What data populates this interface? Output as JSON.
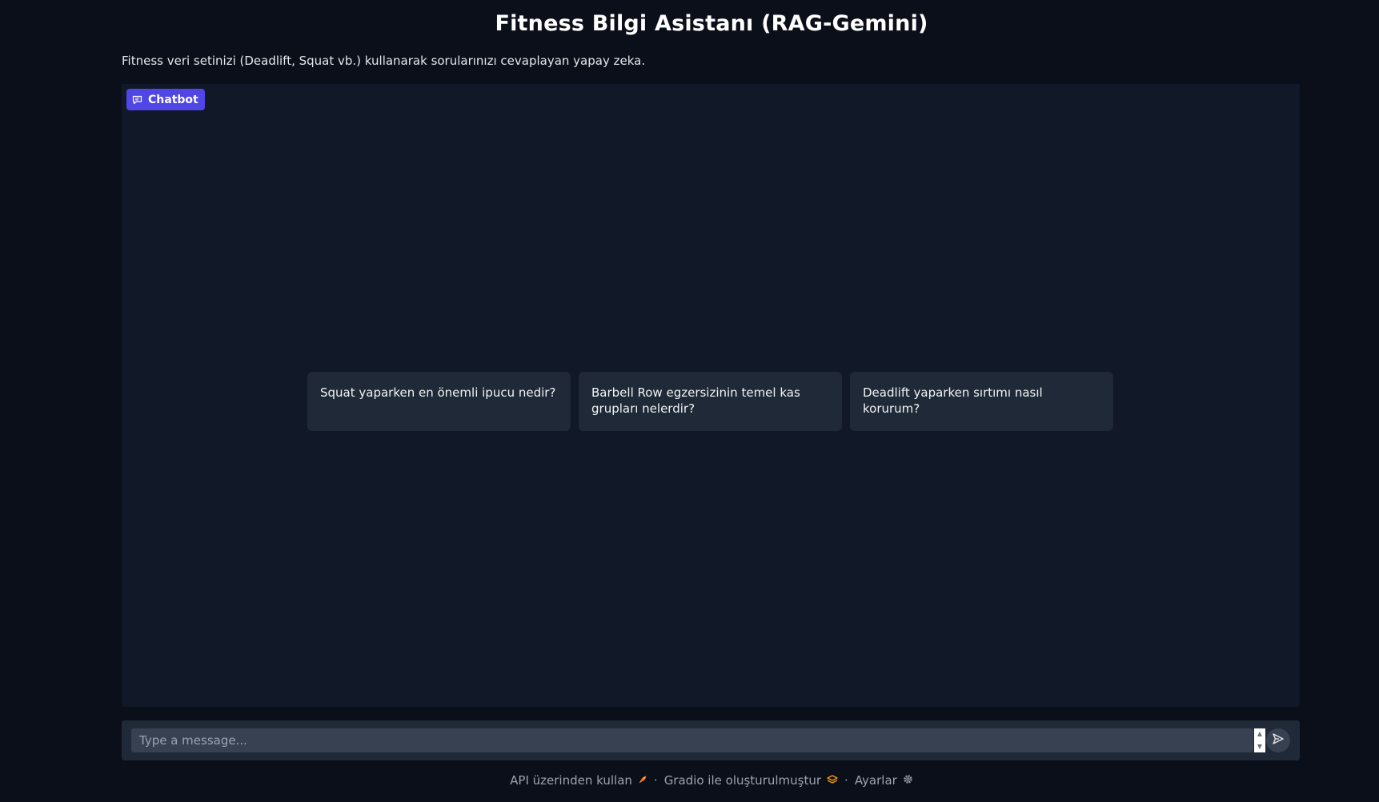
{
  "header": {
    "title": "Fitness Bilgi Asistanı (RAG-Gemini)",
    "description": "Fitness veri setinizi (Deadlift, Squat vb.) kullanarak sorularınızı cevaplayan yapay zeka."
  },
  "chatbot": {
    "label": "Chatbot",
    "icon": "chat-icon",
    "accent_color": "#4f46e5",
    "examples": [
      "Squat yaparken en önemli ipucu nedir?",
      "Barbell Row egzersizinin temel kas grupları nelerdir?",
      "Deadlift yaparken sırtımı nasıl korurum?"
    ]
  },
  "input": {
    "placeholder": "Type a message...",
    "value": "",
    "send_icon": "send-icon"
  },
  "footer": {
    "api_label": "API üzerinden kullan",
    "api_icon": "rocket-icon",
    "separator": "·",
    "gradio_label": "Gradio ile oluşturulmuştur",
    "gradio_icon": "gradio-logo-icon",
    "settings_label": "Ayarlar",
    "settings_icon": "gear-icon"
  }
}
